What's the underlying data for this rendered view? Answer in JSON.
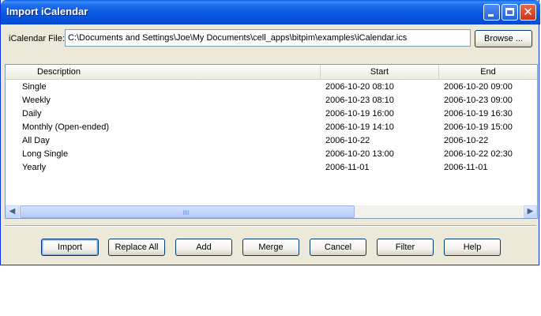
{
  "window": {
    "title": "Import iCalendar"
  },
  "file": {
    "label": "iCalendar File:",
    "value": "C:\\Documents and Settings\\Joe\\My Documents\\cell_apps\\bitpim\\examples\\iCalendar.ics",
    "browse_label": "Browse ..."
  },
  "table": {
    "columns": [
      "Description",
      "Start",
      "End"
    ],
    "rows": [
      {
        "description": "Single",
        "start": "2006-10-20  08:10",
        "end": "2006-10-20  09:00"
      },
      {
        "description": "Weekly",
        "start": "2006-10-23  08:10",
        "end": "2006-10-23  09:00"
      },
      {
        "description": "Daily",
        "start": "2006-10-19  16:00",
        "end": "2006-10-19  16:30"
      },
      {
        "description": "Monthly (Open-ended)",
        "start": "2006-10-19  14:10",
        "end": "2006-10-19  15:00"
      },
      {
        "description": "All Day",
        "start": "2006-10-22",
        "end": "2006-10-22"
      },
      {
        "description": "Long Single",
        "start": "2006-10-20  13:00",
        "end": "2006-10-22  02:30"
      },
      {
        "description": "Yearly",
        "start": "2006-11-01",
        "end": "2006-11-01"
      }
    ]
  },
  "buttons": {
    "import": "Import",
    "replace_all": "Replace All",
    "add": "Add",
    "merge": "Merge",
    "cancel": "Cancel",
    "filter": "Filter",
    "help": "Help"
  },
  "icons": {
    "minimize": "minimize-icon",
    "maximize": "maximize-icon",
    "close": "close-icon",
    "scroll_left": "chevron-left-icon",
    "scroll_right": "chevron-right-icon"
  },
  "colors": {
    "titlebar": "#0a56e0",
    "face": "#ece9d8",
    "close_button": "#c4371a"
  }
}
